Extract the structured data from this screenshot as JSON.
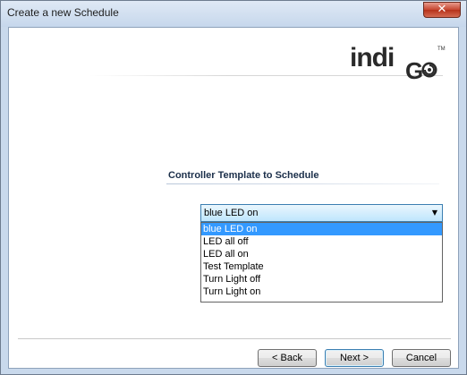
{
  "window": {
    "title": "Create a new Schedule"
  },
  "header": {
    "logo_text": "indi",
    "logo_trademark": "TM",
    "logo_icon": "go-swirl-logo"
  },
  "section": {
    "title": "Controller Template to Schedule"
  },
  "template_select": {
    "selected_value": "blue LED on",
    "arrow_icon": "chevron-down-icon",
    "options": [
      "blue LED on",
      "LED all off",
      "LED all on",
      "Test Template",
      "Turn Light off",
      "Turn Light on"
    ],
    "highlighted_index": 0
  },
  "footer": {
    "back_label": "< Back",
    "next_label": "Next >",
    "cancel_label": "Cancel"
  },
  "colors": {
    "highlight": "#3399ff",
    "close_button": "#c5452f",
    "frame": "#c9d9ec"
  }
}
